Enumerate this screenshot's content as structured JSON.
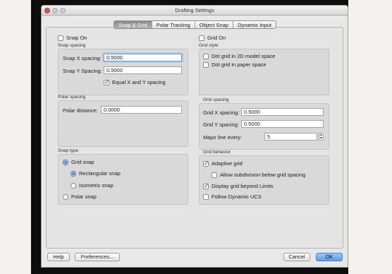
{
  "window": {
    "title": "Drafting Settings"
  },
  "tabs": [
    {
      "label": "Snap & Grid",
      "active": true
    },
    {
      "label": "Polar Tracking",
      "active": false
    },
    {
      "label": "Object Snap",
      "active": false
    },
    {
      "label": "Dynamic Input",
      "active": false
    }
  ],
  "snap": {
    "on_label": "Snap On",
    "on_checked": false,
    "spacing_group": "Snap spacing",
    "x_label": "Snap X spacing:",
    "x_value": "0.5000",
    "y_label": "Snap Y Spacing:",
    "y_value": "0.5000",
    "equal_label": "Equal X and Y spacing",
    "equal_checked": true
  },
  "polar": {
    "group": "Polar spacing",
    "distance_label": "Polar distance:",
    "distance_value": "0.0000"
  },
  "snap_type": {
    "group": "Snap type",
    "grid_snap": "Grid snap",
    "rectangular": "Rectangular snap",
    "isometric": "Isometric snap",
    "polar_snap": "Polar snap"
  },
  "grid": {
    "on_label": "Grid On",
    "on_checked": false,
    "style_group": "Grid style",
    "dot_model": "Dot grid in 2D model space",
    "dot_paper": "Dot grid in paper space",
    "spacing_group": "Grid spacing",
    "x_label": "Grid X spacing:",
    "x_value": "0.5000",
    "y_label": "Grid Y spacing:",
    "y_value": "0.5000",
    "major_label": "Major line every:",
    "major_value": "5"
  },
  "behavior": {
    "group": "Grid behavior",
    "adaptive": "Adaptive grid",
    "adaptive_checked": true,
    "subdivision": "Allow subdivision below grid spacing",
    "subdivision_checked": false,
    "beyond_limits": "Display grid beyond Limits",
    "beyond_checked": true,
    "dynamic_ucs": "Follow Dynamic UCS",
    "dynamic_checked": false
  },
  "buttons": {
    "help": "Help",
    "preferences": "Preferences...",
    "cancel": "Cancel",
    "ok": "OK"
  },
  "colors": {
    "accent": "#5a9de6",
    "close": "#e0524a"
  }
}
